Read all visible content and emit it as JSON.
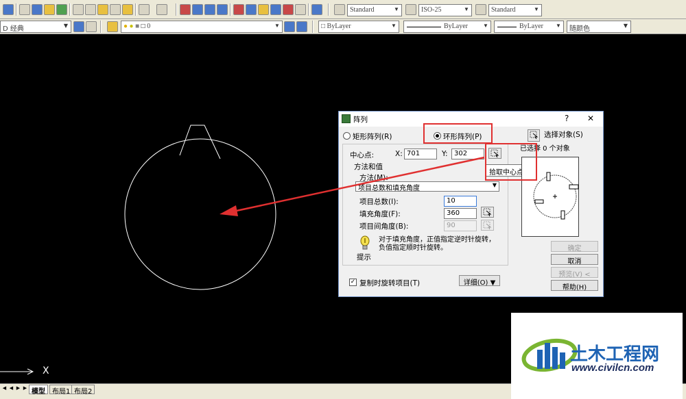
{
  "toolbar1": {
    "textstyle": "Standard",
    "dimstyle": "ISO-25",
    "tablestyle": "Standard"
  },
  "toolbar2": {
    "workspace": "D 经典",
    "layer": "0",
    "color": "ByLayer",
    "linetype": "ByLayer",
    "lineweight": "ByLayer",
    "plotstyle": "随颜色"
  },
  "canvas": {
    "ucs_x_label": "X"
  },
  "layout_tabs": [
    "模型",
    "布局1",
    "布局2"
  ],
  "dialog": {
    "title": "阵列",
    "help": "?",
    "close": "✕",
    "rect_array_label": "矩形阵列(R)",
    "polar_array_label": "环形阵列(P)",
    "select_objects_label": "选择对象(S)",
    "selected_count": "已选择 0 个对象",
    "center_point_label": "中心点:",
    "x_label": "X:",
    "x_value": "701",
    "y_label": "Y:",
    "y_value": "302",
    "tooltip": "拾取中心点",
    "method_group": "方法和值",
    "method_label": "方法(M):",
    "method_value": "项目总数和填充角度",
    "total_items_label": "项目总数(I):",
    "total_items_value": "10",
    "fill_angle_label": "填充角度(F):",
    "fill_angle_value": "360",
    "item_angle_label": "项目间角度(B):",
    "item_angle_value": "90",
    "tip_text": "对于填充角度，正值指定逆时针旋转，负值指定顺时针旋转。",
    "tip_label": "提示",
    "rotate_items_label": "复制时旋转项目(T)",
    "details_button": "详细(O) ▼",
    "ok_button": "确定",
    "cancel_button": "取消",
    "preview_button": "预览(V) <",
    "help_button": "帮助(H)"
  },
  "watermark": {
    "brand": "土木工程网",
    "url": "www.civilcn.com"
  },
  "colors": {
    "highlight_red": "#e03030",
    "canvas_bg": "#000000",
    "drawing_line": "#ffffff",
    "brand_blue": "#1e63b4",
    "brand_green": "#7ab532"
  }
}
